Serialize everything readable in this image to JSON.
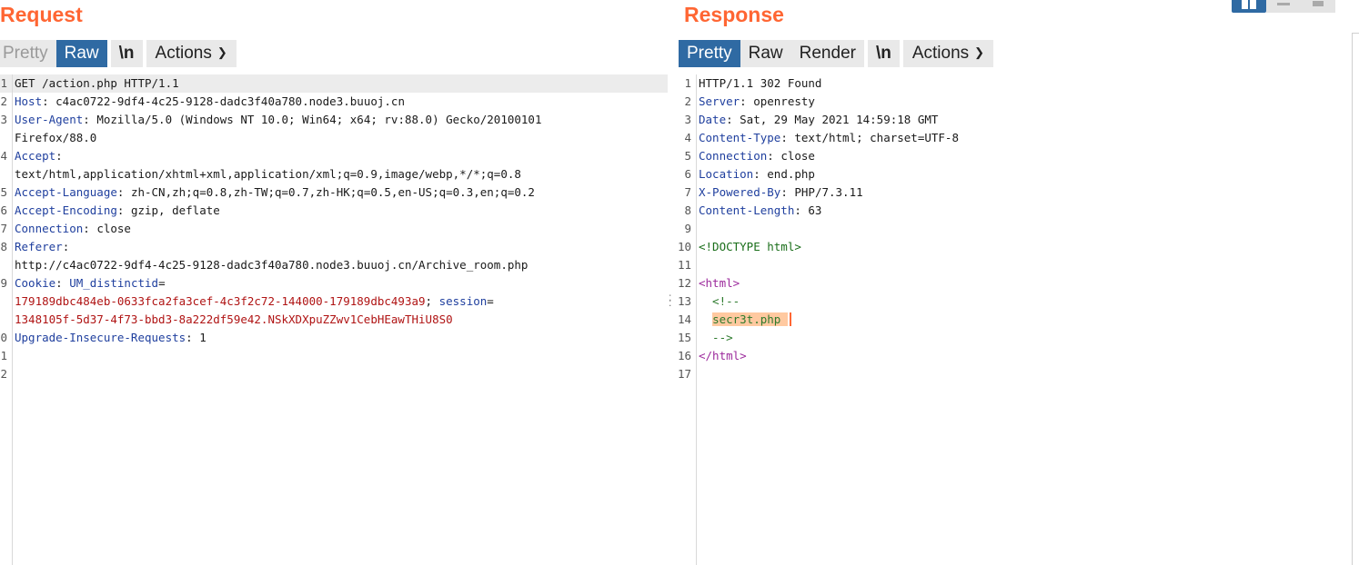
{
  "request": {
    "title": "Request",
    "tabs": [
      "Pretty",
      "Raw",
      "\\n"
    ],
    "actions_label": "Actions",
    "lines": [
      {
        "n": "1",
        "parts": [
          {
            "t": "GET /action.php HTTP/1.1",
            "c": "val"
          }
        ],
        "hl": true
      },
      {
        "n": "2",
        "parts": [
          {
            "t": "Host",
            "c": "hname"
          },
          {
            "t": ": c4ac0722-9df4-4c25-9128-dadc3f40a780.node3.buuoj.cn",
            "c": "val"
          }
        ]
      },
      {
        "n": "3",
        "parts": [
          {
            "t": "User-Agent",
            "c": "hname"
          },
          {
            "t": ": Mozilla/5.0 (Windows NT 10.0; Win64; x64; rv:88.0) Gecko/20100101",
            "c": "val"
          }
        ]
      },
      {
        "n": "",
        "parts": [
          {
            "t": "Firefox/88.0",
            "c": "val"
          }
        ]
      },
      {
        "n": "4",
        "parts": [
          {
            "t": "Accept",
            "c": "hname"
          },
          {
            "t": ":",
            "c": "val"
          }
        ]
      },
      {
        "n": "",
        "parts": [
          {
            "t": "text/html,application/xhtml+xml,application/xml;q=0.9,image/webp,*/*;q=0.8",
            "c": "val"
          }
        ]
      },
      {
        "n": "5",
        "parts": [
          {
            "t": "Accept-Language",
            "c": "hname"
          },
          {
            "t": ": zh-CN,zh;q=0.8,zh-TW;q=0.7,zh-HK;q=0.5,en-US;q=0.3,en;q=0.2",
            "c": "val"
          }
        ]
      },
      {
        "n": "6",
        "parts": [
          {
            "t": "Accept-Encoding",
            "c": "hname"
          },
          {
            "t": ": gzip, deflate",
            "c": "val"
          }
        ]
      },
      {
        "n": "7",
        "parts": [
          {
            "t": "Connection",
            "c": "hname"
          },
          {
            "t": ": close",
            "c": "val"
          }
        ]
      },
      {
        "n": "8",
        "parts": [
          {
            "t": "Referer",
            "c": "hname"
          },
          {
            "t": ":",
            "c": "val"
          }
        ]
      },
      {
        "n": "",
        "parts": [
          {
            "t": "http://c4ac0722-9df4-4c25-9128-dadc3f40a780.node3.buuoj.cn/Archive_room.php",
            "c": "val"
          }
        ]
      },
      {
        "n": "9",
        "parts": [
          {
            "t": "Cookie",
            "c": "hname"
          },
          {
            "t": ": ",
            "c": "val"
          },
          {
            "t": "UM_distinctid",
            "c": "hname"
          },
          {
            "t": "=",
            "c": "val"
          }
        ]
      },
      {
        "n": "",
        "parts": [
          {
            "t": "179189dbc484eb-0633fca2fa3cef-4c3f2c72-144000-179189dbc493a9",
            "c": "cookie"
          },
          {
            "t": "; ",
            "c": "val"
          },
          {
            "t": "session",
            "c": "hname"
          },
          {
            "t": "=",
            "c": "val"
          }
        ]
      },
      {
        "n": "",
        "parts": [
          {
            "t": "1348105f-5d37-4f73-bbd3-8a222df59e42.NSkXDXpuZZwv1CebHEawTHiU8S0",
            "c": "cookie"
          }
        ]
      },
      {
        "n": "0",
        "parts": [
          {
            "t": "Upgrade-Insecure-Requests",
            "c": "hname"
          },
          {
            "t": ": 1",
            "c": "val"
          }
        ]
      },
      {
        "n": "1",
        "parts": []
      },
      {
        "n": "2",
        "parts": []
      }
    ]
  },
  "response": {
    "title": "Response",
    "tabs": [
      "Pretty",
      "Raw",
      "Render"
    ],
    "newline_label": "\\n",
    "actions_label": "Actions",
    "lines": [
      {
        "n": "1",
        "parts": [
          {
            "t": "HTTP/1.1 302 Found",
            "c": "val"
          }
        ]
      },
      {
        "n": "2",
        "parts": [
          {
            "t": "Server",
            "c": "hname"
          },
          {
            "t": ": openresty",
            "c": "val"
          }
        ]
      },
      {
        "n": "3",
        "parts": [
          {
            "t": "Date",
            "c": "hname"
          },
          {
            "t": ": Sat, 29 May 2021 14:59:18 GMT",
            "c": "val"
          }
        ]
      },
      {
        "n": "4",
        "parts": [
          {
            "t": "Content-Type",
            "c": "hname"
          },
          {
            "t": ": text/html; charset=UTF-8",
            "c": "val"
          }
        ]
      },
      {
        "n": "5",
        "parts": [
          {
            "t": "Connection",
            "c": "hname"
          },
          {
            "t": ": close",
            "c": "val"
          }
        ]
      },
      {
        "n": "6",
        "parts": [
          {
            "t": "Location",
            "c": "hname"
          },
          {
            "t": ": end.php",
            "c": "val"
          }
        ]
      },
      {
        "n": "7",
        "parts": [
          {
            "t": "X-Powered-By",
            "c": "hname"
          },
          {
            "t": ": PHP/7.3.11",
            "c": "val"
          }
        ]
      },
      {
        "n": "8",
        "parts": [
          {
            "t": "Content-Length",
            "c": "hname"
          },
          {
            "t": ": 63",
            "c": "val"
          }
        ]
      },
      {
        "n": "9",
        "parts": []
      },
      {
        "n": "10",
        "parts": [
          {
            "t": "<!DOCTYPE html>",
            "c": "doctype"
          }
        ]
      },
      {
        "n": "11",
        "parts": []
      },
      {
        "n": "12",
        "parts": [
          {
            "t": "<html>",
            "c": "tag"
          }
        ]
      },
      {
        "n": "13",
        "parts": [
          {
            "t": "  <!--",
            "c": "comment"
          }
        ]
      },
      {
        "n": "14",
        "parts": [
          {
            "t": "  ",
            "c": "val"
          },
          {
            "t": "secr3t.php ",
            "c": "comment sel"
          },
          {
            "t": "",
            "c": "caret"
          }
        ]
      },
      {
        "n": "15",
        "parts": [
          {
            "t": "  -->",
            "c": "comment"
          }
        ]
      },
      {
        "n": "16",
        "parts": [
          {
            "t": "</html>",
            "c": "tag"
          }
        ]
      },
      {
        "n": "17",
        "parts": []
      }
    ]
  }
}
